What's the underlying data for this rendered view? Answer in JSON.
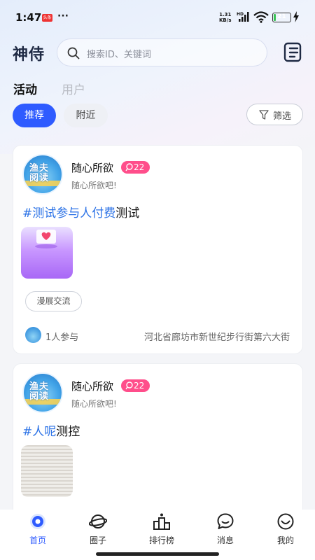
{
  "status_bar": {
    "time": "1:47",
    "app_badge": "头条",
    "more_dots": "···",
    "net_speed_value": "1.31",
    "net_speed_unit": "KB/s",
    "network_type": "HD",
    "battery_level": 21,
    "battery_text": "21"
  },
  "header": {
    "logo_text": "神侍",
    "search_placeholder": "搜索ID、关键词",
    "menu_icon": "list-menu-icon"
  },
  "main_tabs": [
    {
      "label": "活动",
      "active": true
    },
    {
      "label": "用户",
      "active": false
    }
  ],
  "filter_chips": [
    {
      "label": "推荐",
      "active": true
    },
    {
      "label": "附近",
      "active": false
    }
  ],
  "filter_button": {
    "label": "筛选",
    "icon": "funnel-icon"
  },
  "posts": [
    {
      "username": "随心所欲",
      "level": "22",
      "bio": "随心所欲吧!",
      "hashtag": "#测试参与人付费",
      "topic_suffix": "测试",
      "avatar_text": "渔夫\n阅读",
      "image_style": "purple",
      "tag": "漫展交流",
      "participants": "1人参与",
      "location": "河北省廊坊市新世纪步行街第六大街"
    },
    {
      "username": "随心所欲",
      "level": "22",
      "bio": "随心所欲吧!",
      "hashtag": "#人呢",
      "topic_suffix": "测控",
      "avatar_text": "渔夫\n阅读",
      "image_style": "paper"
    }
  ],
  "bottom_nav": [
    {
      "label": "首页",
      "icon": "home-icon",
      "active": true
    },
    {
      "label": "圈子",
      "icon": "planet-icon",
      "active": false
    },
    {
      "label": "排行榜",
      "icon": "podium-icon",
      "active": false
    },
    {
      "label": "消息",
      "icon": "chat-bubble-icon",
      "active": false
    },
    {
      "label": "我的",
      "icon": "smiley-face-icon",
      "active": false
    }
  ],
  "colors": {
    "accent": "#2e5bff",
    "hashtag": "#2b72e6",
    "level_badge": "#ff4e8b",
    "battery_fill": "#39c456"
  }
}
